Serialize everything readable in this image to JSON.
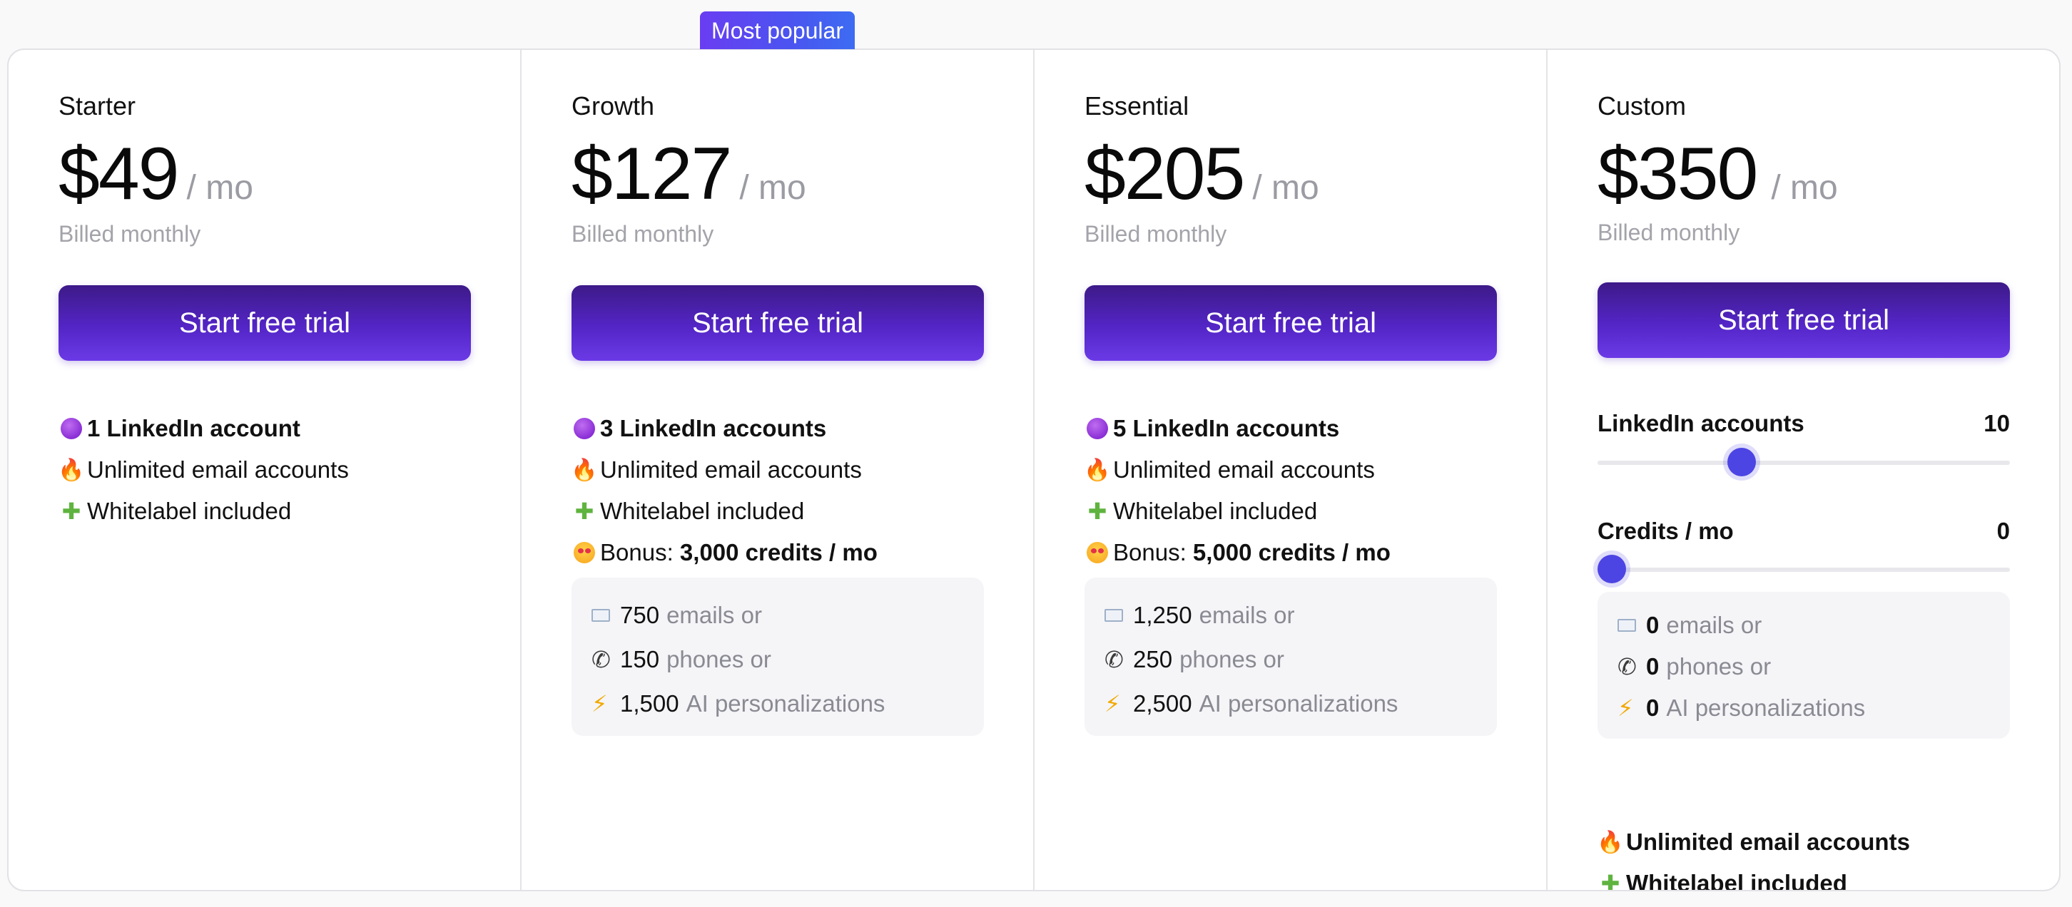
{
  "badge": {
    "label": "Most popular"
  },
  "plans": [
    {
      "name": "Starter",
      "price": "$49",
      "per": "/ mo",
      "billed": "Billed monthly",
      "cta": "Start free trial",
      "features": [
        {
          "icon": "purple-circle-icon",
          "text": "1 LinkedIn account"
        },
        {
          "icon": "fire-icon",
          "text": "Unlimited email accounts"
        },
        {
          "icon": "puzzle-icon",
          "text": "Whitelabel included"
        }
      ]
    },
    {
      "name": "Growth",
      "price": "$127",
      "per": "/ mo",
      "billed": "Billed monthly",
      "cta": "Start free trial",
      "features": [
        {
          "icon": "purple-circle-icon",
          "text": "3 LinkedIn accounts"
        },
        {
          "icon": "fire-icon",
          "text": "Unlimited email accounts"
        },
        {
          "icon": "puzzle-icon",
          "text": "Whitelabel included"
        },
        {
          "icon": "star-struck-icon",
          "prefix": "Bonus: ",
          "text": "3,000 credits / mo"
        }
      ],
      "credits": [
        {
          "icon": "envelope-icon",
          "value": "750",
          "label": "emails or"
        },
        {
          "icon": "phone-icon",
          "value": "150",
          "label": "phones or"
        },
        {
          "icon": "lightning-icon",
          "value": "1,500",
          "label": "AI personalizations"
        }
      ]
    },
    {
      "name": "Essential",
      "price": "$205",
      "per": "/ mo",
      "billed": "Billed monthly",
      "cta": "Start free trial",
      "features": [
        {
          "icon": "purple-circle-icon",
          "text": "5 LinkedIn accounts"
        },
        {
          "icon": "fire-icon",
          "text": "Unlimited email accounts"
        },
        {
          "icon": "puzzle-icon",
          "text": "Whitelabel included"
        },
        {
          "icon": "star-struck-icon",
          "prefix": "Bonus: ",
          "text": "5,000 credits / mo"
        }
      ],
      "credits": [
        {
          "icon": "envelope-icon",
          "value": "1,250",
          "label": "emails or"
        },
        {
          "icon": "phone-icon",
          "value": "250",
          "label": "phones or"
        },
        {
          "icon": "lightning-icon",
          "value": "2,500",
          "label": "AI personalizations"
        }
      ]
    },
    {
      "name": "Custom",
      "price": "$350",
      "per": "/ mo",
      "billed": "Billed monthly",
      "cta": "Start free trial",
      "sliders": [
        {
          "label": "LinkedIn accounts",
          "value": "10",
          "fraction": 0.35
        },
        {
          "label": "Credits / mo",
          "value": "0",
          "fraction": 0.0
        }
      ],
      "credits": [
        {
          "icon": "envelope-icon",
          "value": "0",
          "label": "emails or"
        },
        {
          "icon": "phone-icon",
          "value": "0",
          "label": "phones or"
        },
        {
          "icon": "lightning-icon",
          "value": "0",
          "label": "AI personalizations"
        }
      ],
      "extras": [
        {
          "icon": "fire-icon",
          "text": "Unlimited email accounts"
        },
        {
          "icon": "puzzle-icon",
          "text": "Whitelabel included"
        }
      ]
    }
  ]
}
